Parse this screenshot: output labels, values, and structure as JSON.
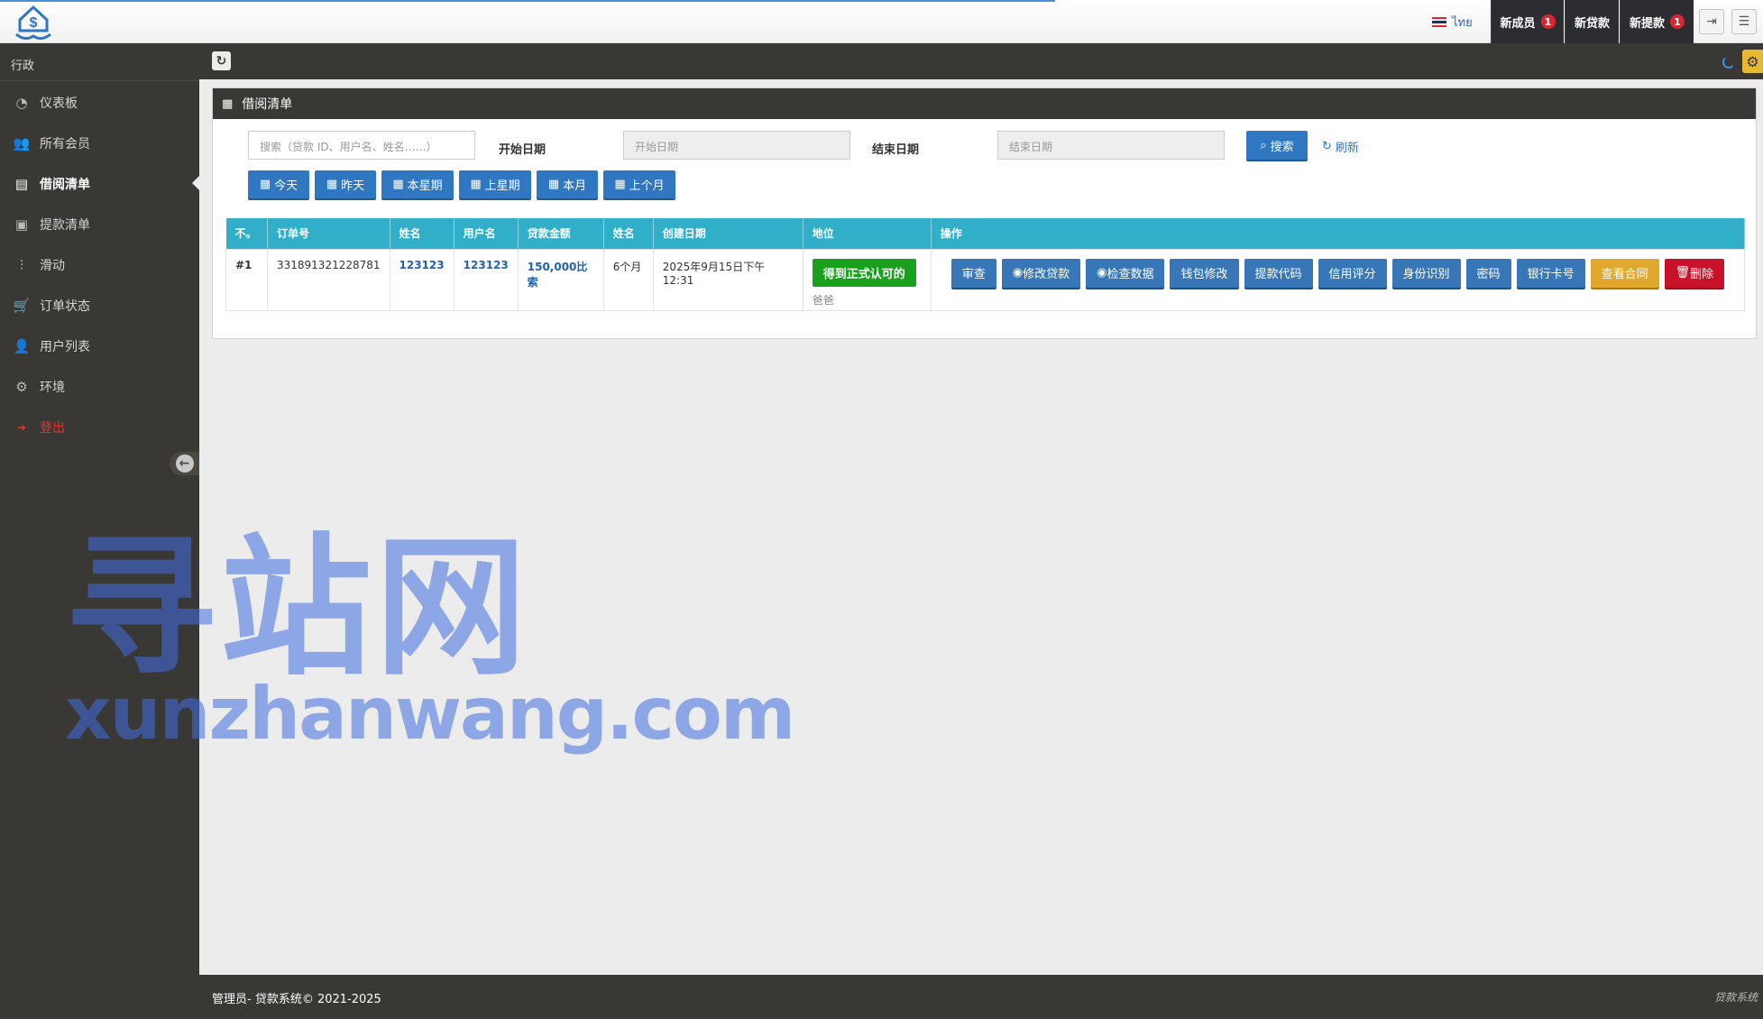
{
  "topbar": {
    "lang_label": "ไทย",
    "notifications": [
      {
        "label": "新成员",
        "badge": "1"
      },
      {
        "label": "新贷款",
        "badge": ""
      },
      {
        "label": "新提款",
        "badge": "1"
      }
    ],
    "icons": [
      "logout-icon",
      "menu-icon"
    ]
  },
  "sidebar": {
    "header": "行政",
    "items": [
      {
        "label": "仪表板",
        "icon": "dashboard-icon"
      },
      {
        "label": "所有会员",
        "icon": "users-icon"
      },
      {
        "label": "借阅清单",
        "icon": "book-icon",
        "active": true
      },
      {
        "label": "提款清单",
        "icon": "money-icon"
      },
      {
        "label": "滑动",
        "icon": "sliders-icon"
      },
      {
        "label": "订单状态",
        "icon": "cart-icon"
      },
      {
        "label": "用户列表",
        "icon": "user-icon"
      },
      {
        "label": "环境",
        "icon": "gear-icon"
      },
      {
        "label": "登出",
        "icon": "signout-icon",
        "color": "#e2342c"
      }
    ]
  },
  "panel": {
    "title": "借阅清单",
    "search_placeholder": "搜索（贷款 ID、用户名、姓名……）",
    "start_label": "开始日期",
    "start_placeholder": "开始日期",
    "end_label": "结束日期",
    "end_placeholder": "结束日期",
    "search_btn": "搜索",
    "refresh_btn": "刷新",
    "presets": [
      "今天",
      "昨天",
      "本星期",
      "上星期",
      "本月",
      "上个月"
    ]
  },
  "table": {
    "headers": [
      "不。",
      "订单号",
      "姓名",
      "用户名",
      "贷款金额",
      "姓名",
      "创建日期",
      "地位",
      "操作"
    ],
    "rows": [
      {
        "no": "#1",
        "order": "331891321228781",
        "name": "123123",
        "username": "123123",
        "amount": "150,000比索",
        "term": "6个月",
        "created": "2025年9月15日下午12:31",
        "status": "得到正式认可的",
        "status_sub": "爸爸",
        "actions": [
          "审查",
          "修改贷款",
          "检查数据",
          "钱包修改",
          "提款代码",
          "信用评分",
          "身份识别",
          "密码",
          "银行卡号",
          "查看合同",
          "删除"
        ]
      }
    ]
  },
  "watermark": {
    "big": "寻站网",
    "small": "xunzhanwang.com"
  },
  "footer": {
    "left": "管理员- 贷款系统© 2021-2025",
    "right": "贷款系统"
  },
  "colors": {
    "sidebar": "#3a3835",
    "header_row": "#31afc9",
    "primary": "#2f77c0",
    "success": "#19a11d",
    "warning": "#e2a72d",
    "danger": "#c9122a"
  }
}
